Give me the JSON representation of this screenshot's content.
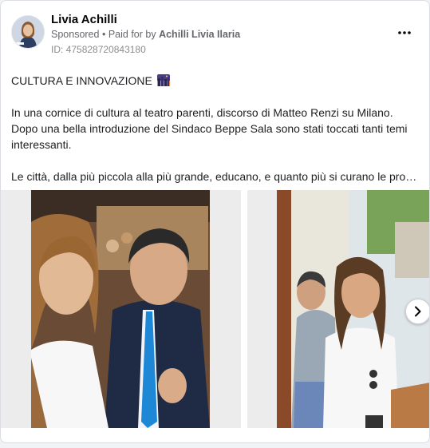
{
  "header": {
    "page_name": "Livia Achilli",
    "sponsored_label": "Sponsored",
    "separator": "•",
    "paid_for_label": "Paid for by",
    "paid_for_name": "Achilli Livia Ilaria",
    "ad_id": "ID: 475828720843180"
  },
  "post": {
    "title": "CULTURA E INNOVAZIONE",
    "title_emoji_icon": "night-city-emoji-icon",
    "paragraph1": "In una cornice di cultura al teatro parenti, discorso di Matteo Renzi su Milano. Dopo una bella introduzione del Sindaco Beppe Sala sono stati toccati tanti temi interessanti.",
    "paragraph2": "Le città, dalla più piccola alla più grande, educano, e quanto più si curano le propr…"
  },
  "carousel": {
    "slides": [
      "photo-selfie-woman-man-blue-tie",
      "photo-woman-street-queue"
    ],
    "next_icon": "chevron-right-icon"
  },
  "colors": {
    "text_primary": "#050505",
    "text_secondary": "#65676b",
    "border": "#dadde1",
    "tie_blue": "#1e88d6"
  }
}
